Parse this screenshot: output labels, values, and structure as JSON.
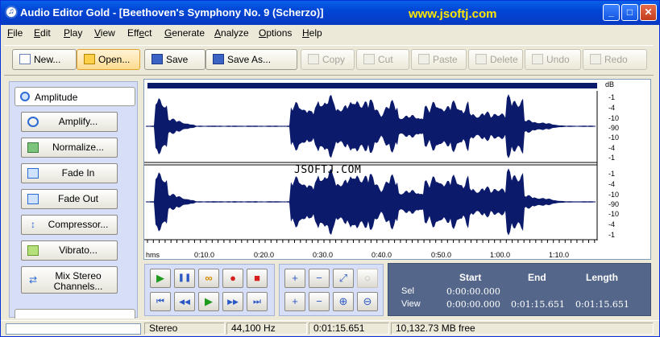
{
  "window": {
    "title": "Audio Editor Gold - [Beethoven's Symphony No. 9 (Scherzo)]",
    "watermark_url": "www.jsoftj.com",
    "controls": {
      "minimize": "_",
      "maximize": "□",
      "close": "✕"
    }
  },
  "menu": [
    {
      "ul": "F",
      "rest": "ile"
    },
    {
      "ul": "E",
      "rest": "dit"
    },
    {
      "ul": "P",
      "rest": "lay"
    },
    {
      "ul": "V",
      "rest": "iew"
    },
    {
      "pre": "Eff",
      "ul": "e",
      "rest": "ct"
    },
    {
      "ul": "G",
      "rest": "enerate"
    },
    {
      "ul": "A",
      "rest": "nalyze"
    },
    {
      "ul": "O",
      "rest": "ptions"
    },
    {
      "ul": "H",
      "rest": "elp"
    }
  ],
  "toolbar": {
    "new": "New...",
    "open": "Open...",
    "save": "Save",
    "save_as": "Save As...",
    "copy": "Copy",
    "cut": "Cut",
    "paste": "Paste",
    "delete": "Delete",
    "undo": "Undo",
    "redo": "Redo"
  },
  "left_panel": {
    "header": "Amplitude",
    "buttons": [
      "Amplify...",
      "Normalize...",
      "Fade In",
      "Fade Out",
      "Compressor...",
      "Vibrato...",
      "Mix Stereo",
      "Channels..."
    ]
  },
  "waveform": {
    "watermark": "JSOFTJ.COM",
    "db_unit": "dB",
    "db_scale_top": [
      "-1",
      "-4",
      "-10",
      "-90",
      "-10",
      "-4",
      "-1"
    ],
    "db_scale_bottom": [
      "-1",
      "-4",
      "-10",
      "-90",
      "-10",
      "-4",
      "-1"
    ],
    "time_labels": [
      "hms",
      "0:10.0",
      "0:20.0",
      "0:30.0",
      "0:40.0",
      "0:50.0",
      "1:00.0",
      "1:10.0"
    ],
    "colors": {
      "wave": "#0b1a6b",
      "background": "#ffffff"
    }
  },
  "transport": {
    "play": "▶",
    "pause": "❚❚",
    "loop": "∞",
    "record": "●",
    "stop": "■",
    "go_start": "⏮",
    "rewind": "◀◀",
    "play_sel": "▶",
    "forward": "▶▶",
    "go_end": "⏭"
  },
  "zoom": [
    "+",
    "−",
    "⤢",
    "○",
    "+",
    "−",
    "⊕",
    "⊖"
  ],
  "selection_info": {
    "headers": {
      "start": "Start",
      "end": "End",
      "length": "Length"
    },
    "sel_label": "Sel",
    "view_label": "View",
    "sel_start": "0:00:00.000",
    "view_start": "0:00:00.000",
    "view_end": "0:01:15.651",
    "view_length": "0:01:15.651"
  },
  "status": {
    "channels": "Stereo",
    "sample_rate": "44,100 Hz",
    "duration": "0:01:15.651",
    "free_space": "10,132.73 MB free"
  }
}
